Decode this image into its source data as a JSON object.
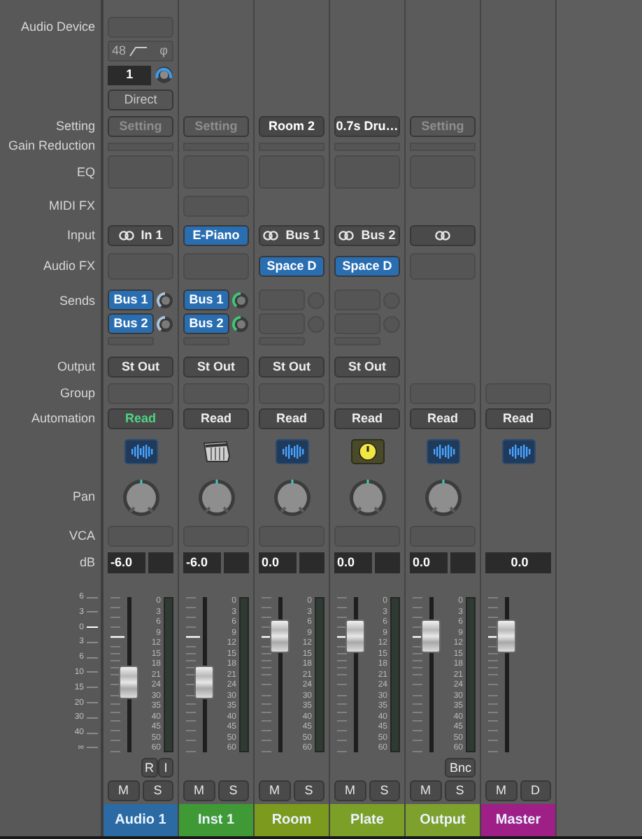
{
  "row_labels": [
    "Audio Device",
    "Setting",
    "Gain Reduction",
    "EQ",
    "MIDI FX",
    "Input",
    "Audio FX",
    "Sends",
    "Output",
    "Group",
    "Automation",
    "Pan",
    "VCA",
    "dB"
  ],
  "fader_scale": [
    "6",
    "3",
    "0",
    "3",
    "6",
    "10",
    "15",
    "20",
    "30",
    "40",
    "∞"
  ],
  "strips": [
    {
      "name": "Audio 1",
      "kind": "audio",
      "color": "#2b6aa3",
      "device": {
        "rate": "48",
        "phase": "φ",
        "channel": "1",
        "mode": "Direct"
      },
      "setting": {
        "text": "Setting",
        "loaded": false
      },
      "input": {
        "kind": "audio",
        "text": "In 1"
      },
      "sends": [
        {
          "text": "Bus 1",
          "color": "#a9c3dc"
        },
        {
          "text": "Bus 2",
          "color": "#a9c3dc"
        }
      ],
      "output": "St Out",
      "automation": {
        "text": "Read",
        "active": true
      },
      "track_icon": {
        "kind": "waveform"
      },
      "db": "-6.0",
      "fader": {
        "level": 0.45,
        "meter_scale": [
          "0",
          "3",
          "6",
          "9",
          "12",
          "15",
          "18",
          "21",
          "24",
          "30",
          "35",
          "40",
          "45",
          "50",
          "60"
        ]
      },
      "extra_buttons": [
        "R",
        "I"
      ],
      "buttons": [
        "M",
        "S"
      ]
    },
    {
      "name": "Inst 1",
      "kind": "instrument",
      "color": "#3f9a35",
      "setting": {
        "text": "Setting",
        "loaded": false
      },
      "input": {
        "kind": "instrument",
        "text": "E-Piano"
      },
      "sends": [
        {
          "text": "Bus 1",
          "color": "#3fc776"
        },
        {
          "text": "Bus 2",
          "color": "#3fc776"
        }
      ],
      "output": "St Out",
      "automation": {
        "text": "Read",
        "active": false
      },
      "track_icon": {
        "kind": "keyboard"
      },
      "db": "-6.0",
      "fader": {
        "level": 0.45,
        "meter_scale": [
          "0",
          "3",
          "6",
          "9",
          "12",
          "15",
          "18",
          "21",
          "24",
          "30",
          "35",
          "40",
          "45",
          "50",
          "60"
        ]
      },
      "buttons": [
        "M",
        "S"
      ]
    },
    {
      "name": "Room",
      "kind": "aux",
      "color": "#7c9a1e",
      "setting": {
        "text": "Room 2",
        "loaded": true
      },
      "input": {
        "kind": "bus",
        "text": "Bus 1"
      },
      "audio_fx": [
        "Space D"
      ],
      "output": "St Out",
      "automation": {
        "text": "Read",
        "active": false
      },
      "track_icon": {
        "kind": "waveform"
      },
      "db": "0.0",
      "fader": {
        "level": 0.75,
        "meter_scale": [
          "0",
          "3",
          "6",
          "9",
          "12",
          "15",
          "18",
          "21",
          "24",
          "30",
          "35",
          "40",
          "45",
          "50",
          "60"
        ]
      },
      "buttons": [
        "M",
        "S"
      ]
    },
    {
      "name": "Plate",
      "kind": "aux",
      "color": "#7c9f28",
      "setting": {
        "text": "0.7s Dru…",
        "loaded": true
      },
      "input": {
        "kind": "bus",
        "text": "Bus 2"
      },
      "audio_fx": [
        "Space D"
      ],
      "output": "St Out",
      "automation": {
        "text": "Read",
        "active": false
      },
      "track_icon": {
        "kind": "dial"
      },
      "db": "0.0",
      "fader": {
        "level": 0.75,
        "meter_scale": [
          "0",
          "3",
          "6",
          "9",
          "12",
          "15",
          "18",
          "21",
          "24",
          "30",
          "35",
          "40",
          "45",
          "50",
          "60"
        ]
      },
      "buttons": [
        "M",
        "S"
      ]
    },
    {
      "name": "Output",
      "kind": "output",
      "color": "#7ea02c",
      "setting": {
        "text": "Setting",
        "loaded": false
      },
      "input": {
        "kind": "stereo"
      },
      "automation": {
        "text": "Read",
        "active": false
      },
      "track_icon": {
        "kind": "waveform"
      },
      "db": "0.0",
      "fader": {
        "level": 0.75,
        "meter_scale": [
          "0",
          "3",
          "6",
          "9",
          "12",
          "15",
          "18",
          "21",
          "24",
          "30",
          "35",
          "40",
          "45",
          "50",
          "60"
        ]
      },
      "extra_buttons": [
        "Bnc"
      ],
      "buttons": [
        "M",
        "S"
      ]
    },
    {
      "name": "Master",
      "kind": "master",
      "color": "#9e1f86",
      "automation": {
        "text": "Read",
        "active": false
      },
      "track_icon": {
        "kind": "waveform"
      },
      "db": "0.0",
      "fader": {
        "level": 0.75
      },
      "buttons": [
        "M",
        "D"
      ]
    }
  ]
}
